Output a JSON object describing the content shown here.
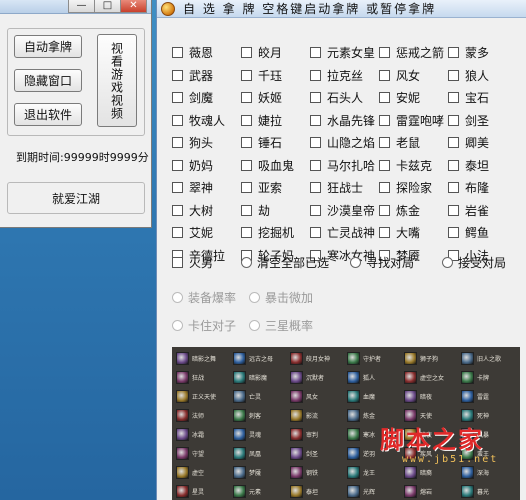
{
  "small_window": {
    "caption_buttons": {
      "minimize": "—",
      "maximize": "□",
      "close": "✕"
    },
    "buttons": {
      "auto_pick": "自动拿牌",
      "hide_window": "隐藏窗口",
      "exit": "退出软件",
      "video_tutorial": "视看游戏视频"
    },
    "expire_text": "到期时间:99999时9999分",
    "footer_text": "就爱江湖"
  },
  "main_window": {
    "title": "自 选 拿 牌   空格键启动拿牌 或暂停拿牌",
    "cards": [
      [
        "薇恩",
        "皎月",
        "元素女皇",
        "惩戒之箭",
        "蒙多"
      ],
      [
        "武器",
        "千珏",
        "拉克丝",
        "风女",
        "狼人"
      ],
      [
        "剑魔",
        "妖姬",
        "石头人",
        "安妮",
        "宝石"
      ],
      [
        "牧魂人",
        "婕拉",
        "水晶先锋",
        "雷霆咆哮",
        "剑圣"
      ],
      [
        "狗头",
        "锤石",
        "山隐之焰",
        "老鼠",
        "卿美"
      ],
      [
        "奶妈",
        "吸血鬼",
        "马尔扎哈",
        "卡兹克",
        "泰坦"
      ],
      [
        "翠神",
        "亚索",
        "狂战士",
        "探险家",
        "布隆"
      ],
      [
        "大树",
        "劫",
        "沙漠皇帝",
        "炼金",
        "岩雀"
      ],
      [
        "艾妮",
        "挖掘机",
        "亡灵战神",
        "大嘴",
        "鳄鱼"
      ],
      [
        "辛德拉",
        "轮子妈",
        "寒冰女神",
        "梦魇",
        "小法"
      ]
    ],
    "last_row": {
      "checkbox": "火男",
      "radios": [
        "清空全部已选",
        "寻找对局",
        "接受对局"
      ]
    },
    "options": [
      [
        "装备爆率",
        "暴击微加"
      ],
      [
        "卡住对子",
        "三星概率"
      ]
    ],
    "game_cells": [
      "暗影之舞",
      "远古之母",
      "皎月女神",
      "守护者",
      "狮子狗",
      "旧人之歌",
      "狂战",
      "暗影魔",
      "沉默者",
      "狐人",
      "虚空之女",
      "卡牌",
      "正义天使",
      "亡灵",
      "风女",
      "血魔",
      "暗夜",
      "雷霆",
      "法师",
      "刺客",
      "影流",
      "炼金",
      "天使",
      "死神",
      "冰霜",
      "灵魂",
      "审判",
      "寒冰",
      "暗夜",
      "风暴",
      "守望",
      "凤凰",
      "剑圣",
      "逆羽",
      "疾风",
      "蛮王",
      "虚空",
      "梦魇",
      "钢铁",
      "龙王",
      "暗裔",
      "深海",
      "星灵",
      "元素",
      "泰坦",
      "光辉",
      "熔岩",
      "暮光",
      "巨魔",
      "纳尔",
      "钢骨",
      "血港",
      "冰晶",
      "猩红",
      "破败",
      "沙皇"
    ],
    "watermark": "脚本之家",
    "watermark_sub": "www.jb51.net"
  },
  "colors": {
    "desktop": "#2f78b2",
    "window_bg": "#f0f0f0",
    "game_bg": "#3d3a36",
    "watermark": "#e02a2a"
  }
}
